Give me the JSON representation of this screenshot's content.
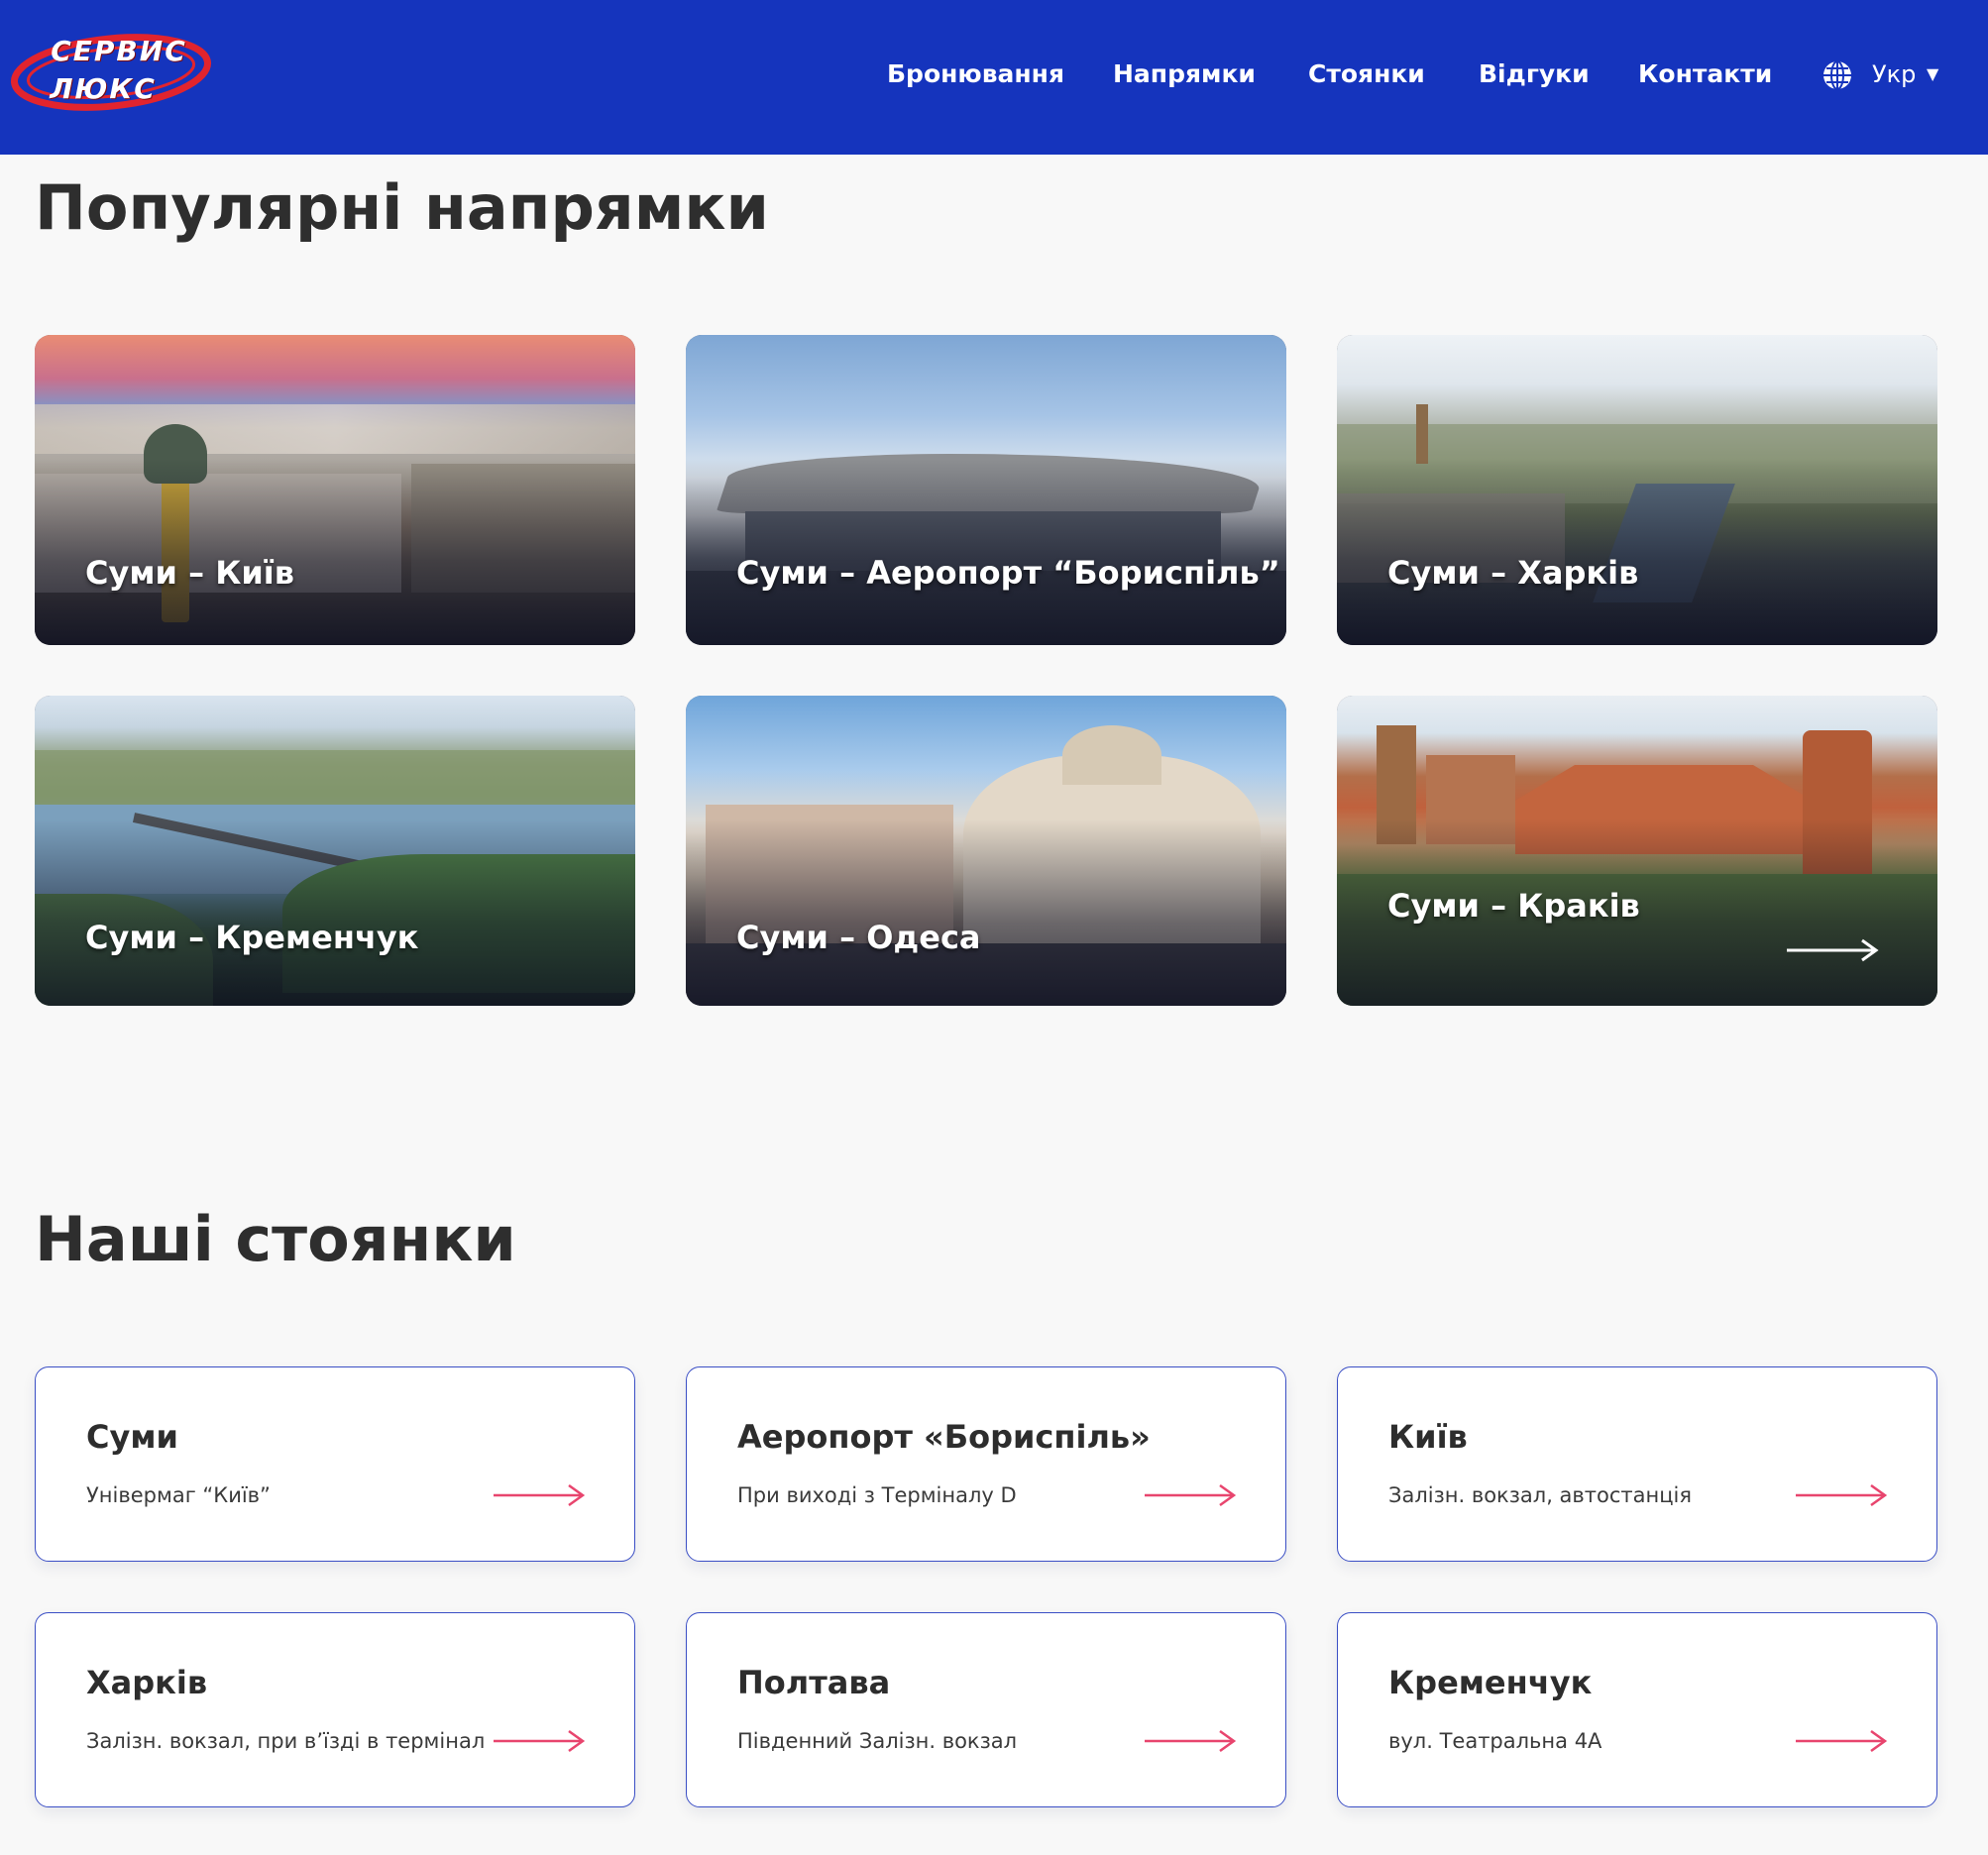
{
  "brand": {
    "line1": "СЕРВИС",
    "line2": "ЛЮКС",
    "colors": {
      "header_bg": "#1534bd",
      "logo_red": "#e1242e",
      "accent_pink": "#e8456e"
    }
  },
  "nav": {
    "items": [
      {
        "label": "Бронювання"
      },
      {
        "label": "Напрямки"
      },
      {
        "label": "Стоянки"
      },
      {
        "label": "Відгуки"
      },
      {
        "label": "Контакти"
      }
    ],
    "language": {
      "label": "Укр",
      "icon": "globe-icon",
      "caret_icon": "caret-down-icon"
    }
  },
  "popular": {
    "title": "Популярні напрямки",
    "routes": [
      {
        "label": "Суми – Київ",
        "image": "kyiv-independence-square-photo"
      },
      {
        "label": "Суми – Аеропорт “Бориспіль”",
        "image": "boryspil-airport-photo"
      },
      {
        "label": "Суми – Харків",
        "image": "kharkiv-river-photo"
      },
      {
        "label": "Суми – Кременчук",
        "image": "kremenchuk-bridge-photo"
      },
      {
        "label": "Суми – Одеса",
        "image": "odesa-opera-house-photo"
      },
      {
        "label": "Суми – Краків",
        "image": "krakow-wawel-photo",
        "icon": "arrow-right-icon"
      }
    ]
  },
  "stations": {
    "title": "Наші стоянки",
    "items": [
      {
        "name": "Суми",
        "desc": "Універмаг “Київ”"
      },
      {
        "name": "Аеропорт «Бориспіль»",
        "desc": "При виході з Терміналу D"
      },
      {
        "name": "Київ",
        "desc": "Залізн. вокзал, автостанція"
      },
      {
        "name": "Харків",
        "desc": "Залізн. вокзал, при в’їзді в термінал"
      },
      {
        "name": "Полтава",
        "desc": "Південний Залізн. вокзал"
      },
      {
        "name": "Кременчук",
        "desc": "вул. Театральна 4А"
      }
    ],
    "arrow_icon": "arrow-right-icon"
  }
}
